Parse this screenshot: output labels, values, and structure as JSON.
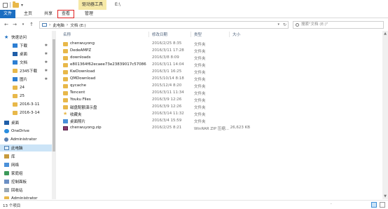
{
  "titlebar": {
    "contextual_tab": "驱动器工具",
    "title": "E:\\"
  },
  "ribbon": {
    "tabs": [
      "文件",
      "主页",
      "共享",
      "查看",
      "管理"
    ]
  },
  "navbar": {
    "breadcrumb": [
      "此电脑",
      "文档 (E:)"
    ],
    "search_placeholder": "搜索\"文档 (E:)\""
  },
  "sidebar": {
    "items": [
      {
        "label": "快速访问",
        "icon": "star-icon",
        "pinned": false
      },
      {
        "label": "下载",
        "icon": "download-icon",
        "pinned": true
      },
      {
        "label": "桌面",
        "icon": "desktop-icon",
        "pinned": true
      },
      {
        "label": "文档",
        "icon": "document-icon",
        "pinned": true
      },
      {
        "label": "2345下载",
        "icon": "folder-icon",
        "pinned": true
      },
      {
        "label": "图片",
        "icon": "pictures-icon",
        "pinned": true
      },
      {
        "label": "24",
        "icon": "folder-icon",
        "pinned": false
      },
      {
        "label": "25",
        "icon": "folder-icon",
        "pinned": false
      },
      {
        "label": "2016-3-11",
        "icon": "folder-icon",
        "pinned": false
      },
      {
        "label": "2016-3-14",
        "icon": "folder-icon",
        "pinned": false
      },
      {
        "label": "桌面",
        "icon": "desktop-icon",
        "pinned": false
      },
      {
        "label": "OneDrive",
        "icon": "cloud-icon",
        "pinned": false
      },
      {
        "label": "Administrator",
        "icon": "user-icon",
        "pinned": false
      },
      {
        "label": "此电脑",
        "icon": "pc-icon",
        "pinned": false,
        "selected": true
      },
      {
        "label": "库",
        "icon": "library-icon",
        "pinned": false
      },
      {
        "label": "网络",
        "icon": "network-icon",
        "pinned": false
      },
      {
        "label": "家庭组",
        "icon": "homegroup-icon",
        "pinned": false
      },
      {
        "label": "控制面板",
        "icon": "control-panel-icon",
        "pinned": false
      },
      {
        "label": "回收站",
        "icon": "recycle-bin-icon",
        "pinned": false
      },
      {
        "label": "Administrator",
        "icon": "folder-icon",
        "pinned": false
      }
    ]
  },
  "filelist": {
    "columns": [
      "名称",
      "修改日期",
      "类型",
      "大小"
    ],
    "rows": [
      {
        "name": "chenwuyong",
        "date": "2016/2/25 8:35",
        "type": "文件夹",
        "size": "",
        "icon": "folder"
      },
      {
        "name": "DedeAMPZ",
        "date": "2016/3/11 17:28",
        "type": "文件夹",
        "size": "",
        "icon": "folder"
      },
      {
        "name": "downloads",
        "date": "2016/3/8 8:09",
        "type": "文件夹",
        "size": "",
        "icon": "folder"
      },
      {
        "name": "e801364f62ecaee73e23839017c57086",
        "date": "2016/3/11 14:04",
        "type": "文件夹",
        "size": "",
        "icon": "folder"
      },
      {
        "name": "KwDownload",
        "date": "2016/3/1 16:25",
        "type": "文件夹",
        "size": "",
        "icon": "folder"
      },
      {
        "name": "QMDownload",
        "date": "2015/10/14 8:18",
        "type": "文件夹",
        "size": "",
        "icon": "folder"
      },
      {
        "name": "qycache",
        "date": "2015/12/4 8:20",
        "type": "文件夹",
        "size": "",
        "icon": "folder"
      },
      {
        "name": "Tencent",
        "date": "2016/3/11 11:34",
        "type": "文件夹",
        "size": "",
        "icon": "folder"
      },
      {
        "name": "Youku Files",
        "date": "2016/3/9 12:26",
        "type": "文件夹",
        "size": "",
        "icon": "folder"
      },
      {
        "name": "磁盘配额演示盘",
        "date": "2016/3/9 12:26",
        "type": "文件夹",
        "size": "",
        "icon": "folder"
      },
      {
        "name": "收藏夹",
        "date": "2016/3/14 11:32",
        "type": "文件夹",
        "size": "",
        "icon": "fav"
      },
      {
        "name": "桌面照片",
        "date": "2016/3/4 15:59",
        "type": "文件夹",
        "size": "",
        "icon": "desk"
      },
      {
        "name": "chenwuyong.zip",
        "date": "2016/2/25 8:21",
        "type": "WinRAR ZIP 压缩...",
        "size": "26,623 KB",
        "icon": "zip"
      }
    ]
  },
  "statusbar": {
    "count": "13 个项目",
    "right_text": "."
  }
}
